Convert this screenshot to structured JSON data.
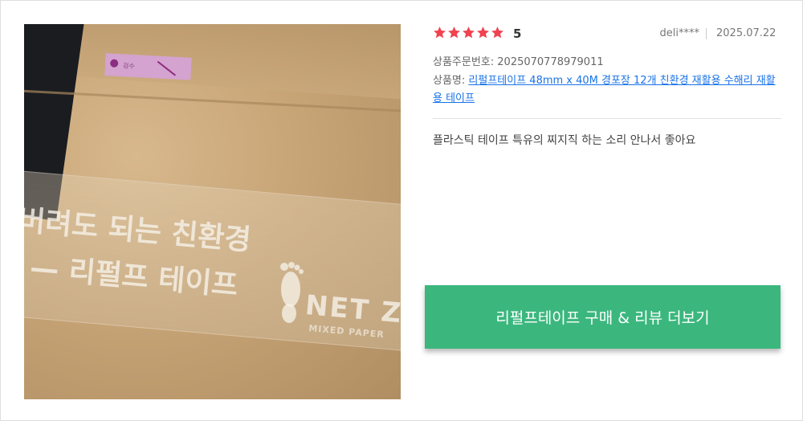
{
  "photo": {
    "tape_line_1": "버려도 되는 친환경",
    "tape_line_2": "— 리펄프 테이프",
    "tape_brand": "NET ZERO",
    "tape_small": "MIXED PAPER",
    "sticker_text": "검수"
  },
  "review": {
    "rating": 5,
    "rating_text": "5",
    "star_color": "#f0424f",
    "user": "deli****",
    "date": "2025.07.22",
    "order_number": "상품주문번호: 2025070778979011",
    "product_label": "상품명: ",
    "product_link": "리펄프테이프 48mm x 40M 경포장 12개 친환경 재활용 수해리 재활용 테이프",
    "text": "플라스틱 테이프 특유의 찌지직 하는 소리 안나서 좋아요"
  },
  "cta": {
    "label": "리펄프테이프 구매 & 리뷰 더보기",
    "color": "#3bb77e"
  }
}
